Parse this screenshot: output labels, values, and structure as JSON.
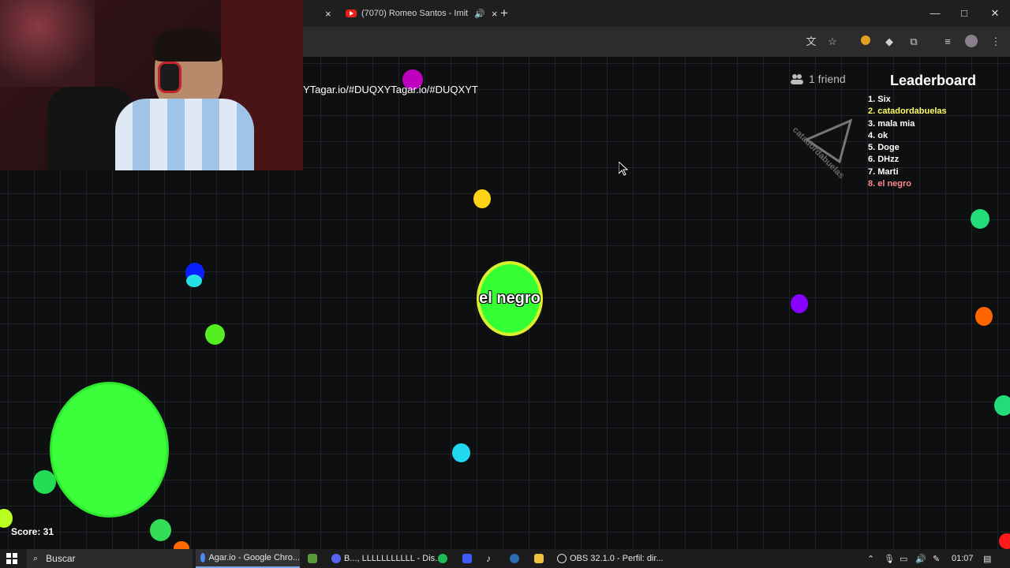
{
  "browser": {
    "active_tab_close": "×",
    "tab2_title": "(7070) Romeo Santos - Imit",
    "tab2_close": "×",
    "new_tab": "+",
    "win_min": "—",
    "win_max": "□",
    "win_close": "✕"
  },
  "game": {
    "party_url": "YTagar.io/#DUQXYTagar.io/#DUQXYT",
    "friends": "1 friend",
    "player_name": "el negro",
    "score_text": "Score: 31",
    "pointer_label": "catadordabuelas",
    "leaderboard": {
      "title": "Leaderboard",
      "entries": [
        {
          "text": "1. Six",
          "color": "#ffffff"
        },
        {
          "text": "2. catadordabuelas",
          "color": "#ffff66"
        },
        {
          "text": "3. mala mia",
          "color": "#ffffff"
        },
        {
          "text": "4. ok",
          "color": "#ffffff"
        },
        {
          "text": "5. Doge",
          "color": "#ffffff"
        },
        {
          "text": "6. DHzz",
          "color": "#ffffff"
        },
        {
          "text": "7. Marti",
          "color": "#ffffff"
        },
        {
          "text": "8. el negro",
          "color": "#ff8a8a"
        }
      ]
    }
  },
  "taskbar": {
    "search_label": "Buscar",
    "item_chrome": "Agar.io - Google Chro...",
    "item_discord": "B..., LLLLLLLLLLL - Dis...",
    "item_obs": "OBS 32.1.0 - Perfil: dir...",
    "clock": "01:07"
  }
}
